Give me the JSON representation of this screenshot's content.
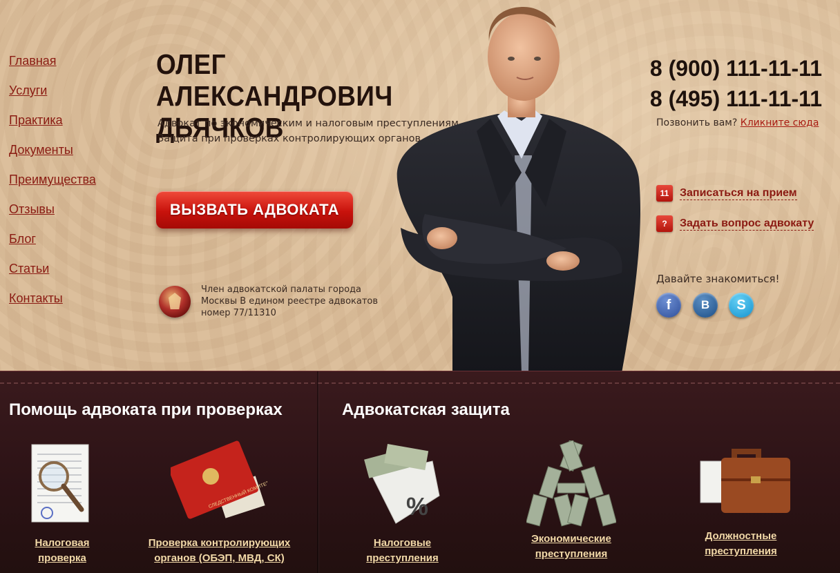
{
  "nav": {
    "items": [
      "Главная",
      "Услуги",
      "Практика",
      "Документы",
      "Преимущества",
      "Отзывы",
      "Блог",
      "Статьи",
      "Контакты"
    ]
  },
  "header": {
    "name_line1": "ОЛЕГ АЛЕКСАНДРОВИЧ",
    "name_line2": "ДЬЯЧКОВ",
    "subtitle_line1": "Адвокат по экономическим и налоговым преступлениям.",
    "subtitle_line2": "Защита при проверках контролирующих органов.",
    "cta_label": "ВЫЗВАТЬ АДВОКАТА",
    "member_text": "Член адвокатской палаты города Москвы В едином реестре адвокатов номер 77/11310"
  },
  "contact": {
    "phone1": "8 (900) 111-11-11",
    "phone2": "8 (495) 111-11-11",
    "callback_question": "Позвонить вам?",
    "callback_link": "Кликните сюда",
    "appointment_icon_text": "11",
    "appointment_label": "Записаться на прием",
    "question_icon_text": "?",
    "question_label": "Задать вопрос адвокату",
    "meet_text": "Давайте знакомиться!",
    "social": {
      "facebook": "f",
      "vk": "B",
      "skype": "S"
    }
  },
  "sections": {
    "checks_title": "Помощь адвоката при проверках",
    "defense_title": "Адвокатская защита",
    "cards": [
      {
        "line1": "Налоговая",
        "line2": "проверка"
      },
      {
        "line1": "Проверка контролирующих",
        "line2": "органов (ОБЭП, МВД, СК)"
      },
      {
        "line1": "Налоговые",
        "line2": "преступления"
      },
      {
        "line1": "Экономические",
        "line2": "преступления"
      },
      {
        "line1": "Должностные",
        "line2": "преступления"
      }
    ],
    "committee_text": "СЛЕДСТВЕННЫЙ КОМИТЕТ"
  },
  "colors": {
    "accent_red": "#c8120c",
    "link_red": "#8a1b12",
    "hero_bg": "#dcbf9c",
    "bottom_bg": "#2b1215",
    "caption_gold": "#f2d9a8"
  }
}
